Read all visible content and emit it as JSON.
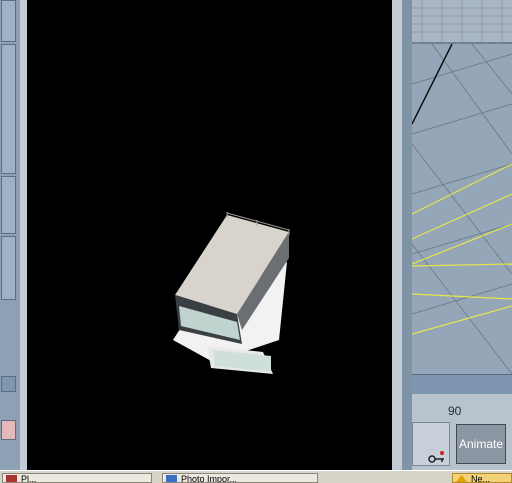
{
  "timeline": {
    "frame_label": "90"
  },
  "controls": {
    "animate_label": "Animate"
  },
  "taskbar": {
    "items": [
      {
        "label": "Pl...",
        "icon": "app-icon"
      },
      {
        "label": "Photo Impor...",
        "icon": "photo-icon"
      },
      {
        "label": "Ne...",
        "icon": "warning-icon"
      }
    ]
  },
  "colors": {
    "viewport_bg": "#000000",
    "ui_blue": "#8d9eb2",
    "guide_yellow": "#e6e64a"
  }
}
